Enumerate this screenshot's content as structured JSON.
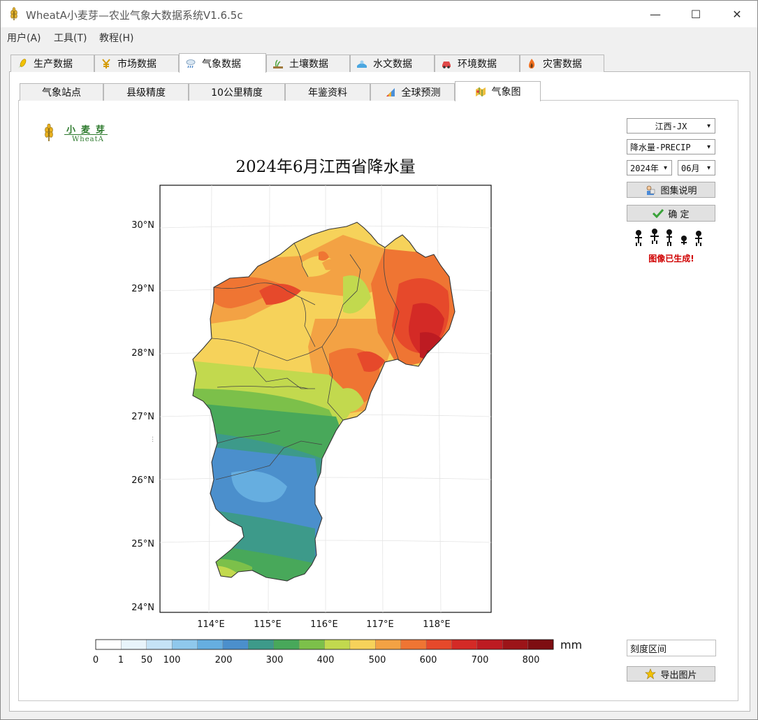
{
  "window": {
    "title": "WheatA小麦芽—农业气象大数据系统V1.6.5c",
    "minimize": "—",
    "maximize": "☐",
    "close": "✕"
  },
  "menu": [
    "用户(A)",
    "工具(T)",
    "教程(H)"
  ],
  "main_tabs": [
    {
      "label": "生产数据",
      "icon": "corn-icon"
    },
    {
      "label": "市场数据",
      "icon": "yen-icon"
    },
    {
      "label": "气象数据",
      "icon": "cloud-rain-icon",
      "active": true
    },
    {
      "label": "土壤数据",
      "icon": "soil-icon"
    },
    {
      "label": "水文数据",
      "icon": "water-icon"
    },
    {
      "label": "环境数据",
      "icon": "car-icon"
    },
    {
      "label": "灾害数据",
      "icon": "fire-icon"
    }
  ],
  "sub_tabs": [
    {
      "label": "气象站点"
    },
    {
      "label": "县级精度"
    },
    {
      "label": "10公里精度"
    },
    {
      "label": "年鉴资料"
    },
    {
      "label": "全球预测",
      "icon": "chart-icon"
    },
    {
      "label": "气象图",
      "icon": "map-icon",
      "active": true
    }
  ],
  "logo": {
    "cn": "小麦芽",
    "en": "WheatA"
  },
  "map": {
    "title": "2024年6月江西省降水量",
    "lat_labels": [
      "30°N",
      "29°N",
      "28°N",
      "27°N",
      "26°N",
      "25°N",
      "24°N"
    ],
    "lon_labels": [
      "114°E",
      "115°E",
      "116°E",
      "117°E",
      "118°E"
    ],
    "colorbar": {
      "unit": "mm",
      "tick_labels": [
        "0",
        "1",
        "50",
        "100",
        "200",
        "300",
        "400",
        "500",
        "600",
        "700",
        "800"
      ],
      "colors": [
        "#ffffff",
        "#e8f4fb",
        "#c5e3f6",
        "#8fc8ec",
        "#66aee0",
        "#4b8fcc",
        "#3d9a8a",
        "#48a85a",
        "#7cc04a",
        "#c2d94e",
        "#f6d25a",
        "#f3a244",
        "#ef7533",
        "#e6492b",
        "#d42a26",
        "#bd1b22",
        "#9c1418",
        "#7e0e12"
      ]
    }
  },
  "controls": {
    "region": "江西-JX",
    "variable": "降水量-PRECIP",
    "year": "2024年",
    "month": "06月",
    "atlas_button": "图集说明",
    "confirm_button": "确  定",
    "status": "图像已生成!",
    "scale_field": "刻度区间",
    "export_button": "导出图片"
  }
}
